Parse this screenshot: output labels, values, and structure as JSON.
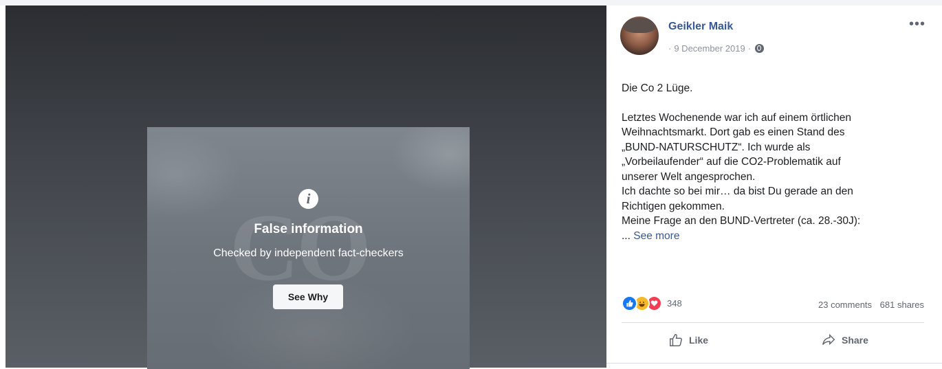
{
  "overlay": {
    "title": "False information",
    "subtitle": "Checked by independent fact-checkers",
    "button_label": "See Why",
    "background_text": "CO"
  },
  "post": {
    "author": "Geikler Maik",
    "date": "9 December 2019",
    "privacy_icon": "globe-icon",
    "menu_icon": "more-options-icon",
    "text_title": "Die Co 2 Lüge.",
    "text_lines": [
      "Letztes Wochenende war ich auf einem örtlichen",
      "Weihnachtsmarkt. Dort gab es einen Stand des",
      "„BUND-NATURSCHUTZ“. Ich wurde als",
      "„Vorbeilaufender“ auf die CO2-Problematik auf",
      "unserer Welt angesprochen.",
      "Ich dachte so bei mir… da bist Du gerade an den",
      "Richtigen gekommen.",
      "Meine Frage an den BUND-Vertreter (ca. 28.-30J):"
    ],
    "ellipsis": "... ",
    "see_more": "See more"
  },
  "engagement": {
    "reaction_count": "348",
    "comments": "23 comments",
    "shares": "681 shares",
    "reaction_icons": [
      "like-reaction-icon",
      "haha-reaction-icon",
      "love-reaction-icon"
    ]
  },
  "actions": {
    "like": "Like",
    "share": "Share"
  },
  "colors": {
    "link": "#385898",
    "like_blue": "#1877f2",
    "haha_yellow": "#f7b928",
    "love_red": "#f33e58"
  }
}
